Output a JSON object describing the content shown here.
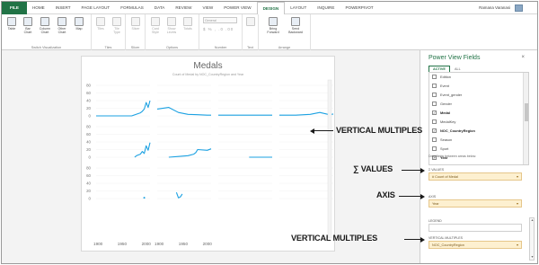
{
  "ribbon": {
    "tabs": [
      "FILE",
      "HOME",
      "INSERT",
      "PAGE LAYOUT",
      "FORMULAS",
      "DATA",
      "REVIEW",
      "VIEW",
      "POWER VIEW",
      "DESIGN",
      "LAYOUT",
      "INQUIRE",
      "POWERPIVOT"
    ],
    "active_tab": "DESIGN",
    "user_name": "Ramana Varanasi",
    "buttons": {
      "table": "Table",
      "bar_chart": "Bar Chart",
      "column_chart": "Column Chart",
      "other_chart": "Other Chart",
      "map": "Map",
      "tiles": "Tiles",
      "tile_type": "Tile Type",
      "slicer": "Slicer",
      "card_style": "Card Style",
      "show_levels": "Show Levels",
      "totals": "Totals",
      "bring_forward": "Bring Forward",
      "send_backward": "Send Backward"
    },
    "number_format": "General",
    "number_symbols": "$ % , .0 .00",
    "groups": {
      "switch_visualization": "Switch Visualization",
      "tiles": "Tiles",
      "slicer": "Slicer",
      "options": "Options",
      "number": "Number",
      "text": "Text",
      "arrange": "Arrange"
    }
  },
  "report": {
    "title": "Medals",
    "subtitle": "Count of Medal by NOC_CountryRegion and Year"
  },
  "chart_data": {
    "type": "line",
    "title": "Medals",
    "subtitle": "Count of Medal by NOC_CountryRegion and Year",
    "layout": "vertical multiples",
    "x_tick_labels": [
      "1900",
      "1950",
      "2000"
    ],
    "y_tick_labels": [
      "0",
      "20",
      "40",
      "60",
      "80"
    ],
    "ylim": [
      0,
      80
    ],
    "series_color": "#1ba1e2",
    "panels": [
      {
        "x": [
          1896,
          1930,
          1970,
          1988,
          1992,
          1996,
          2000,
          2004,
          2008
        ],
        "y": [
          0,
          0,
          0,
          8,
          12,
          18,
          35,
          22,
          40
        ]
      },
      {
        "x": [
          1896,
          1920,
          1940,
          1960,
          1980,
          2000,
          2008
        ],
        "y": [
          18,
          22,
          9,
          4,
          3,
          2,
          2
        ]
      },
      {
        "x": [
          1896,
          1950,
          2000,
          2008
        ],
        "y": [
          2,
          2,
          2,
          2
        ]
      },
      {
        "x": [
          1896,
          1930,
          1960,
          1980,
          2000,
          2008
        ],
        "y": [
          2,
          2,
          4,
          9,
          3,
          5
        ]
      },
      {
        "x": [
          1976,
          1980,
          1988,
          1992,
          1996,
          2000,
          2004,
          2008
        ],
        "y": [
          0,
          4,
          8,
          15,
          10,
          30,
          18,
          38
        ]
      },
      {
        "x": [
          1920,
          1940,
          1960,
          1972,
          1976,
          1980,
          2000,
          2008
        ],
        "y": [
          0,
          2,
          4,
          8,
          12,
          20,
          18,
          22
        ]
      },
      {
        "x": [
          1960,
          1980,
          2000,
          2008
        ],
        "y": [
          0,
          0,
          0,
          0
        ]
      },
      {
        "x": [],
        "y": []
      },
      {
        "x": [
          1996
        ],
        "y": [
          2
        ]
      },
      {
        "x": [
          1936,
          1940,
          1944,
          1948
        ],
        "y": [
          16,
          2,
          4,
          12
        ]
      },
      {
        "x": [],
        "y": []
      },
      {
        "x": [],
        "y": []
      }
    ]
  },
  "fields_pane": {
    "title": "Power View Fields",
    "close": "×",
    "tabs": [
      "ACTIVE",
      "ALL"
    ],
    "fields": [
      {
        "label": "Edition",
        "checked": false,
        "bold": false
      },
      {
        "label": "Event",
        "checked": false,
        "bold": false
      },
      {
        "label": "Event_gender",
        "checked": false,
        "bold": false
      },
      {
        "label": "Gender",
        "checked": false,
        "bold": false
      },
      {
        "label": "Medal",
        "checked": true,
        "bold": true
      },
      {
        "label": "MedalKey",
        "checked": false,
        "bold": false
      },
      {
        "label": "NOC_CountryRegion",
        "checked": true,
        "bold": true
      },
      {
        "label": "Season",
        "checked": false,
        "bold": false
      },
      {
        "label": "Sport",
        "checked": false,
        "bold": false
      },
      {
        "label": "Year",
        "checked": true,
        "bold": true
      }
    ],
    "drag_hint": "Drag fields between areas below:",
    "sections": {
      "values_label": "Σ VALUES",
      "values_field": "# Count of Medal",
      "axis_label": "AXIS",
      "axis_field": "Year",
      "legend_label": "LEGEND",
      "vertical_label": "VERTICAL MULTIPLES",
      "vertical_field": "NOC_CountryRegion"
    }
  },
  "callouts": {
    "vertical_multiples_top": "VERTICAL MULTIPLES",
    "values": "∑ VALUES",
    "axis": "AXIS",
    "vertical_multiples_bottom": "VERTICAL MULTIPLES"
  },
  "colors": {
    "accent": "#217346",
    "line": "#1ba1e2",
    "field_highlight": "#fdf0d0"
  }
}
